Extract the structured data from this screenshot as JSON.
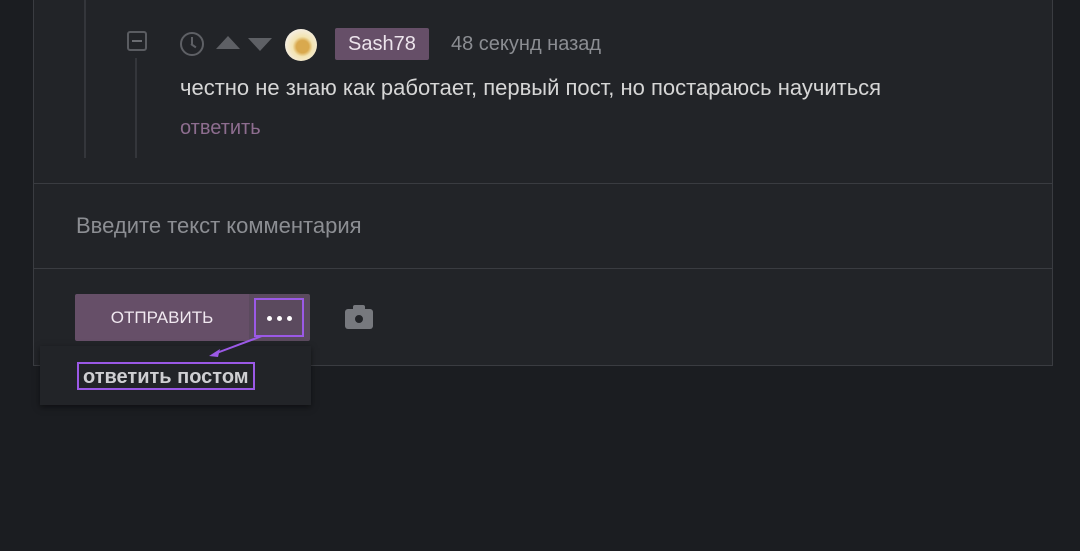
{
  "comment": {
    "author": "Sash78",
    "time": "48 секунд назад",
    "text": "честно не знаю как работает, первый пост, но постараюсь научиться",
    "reply_label": "ответить"
  },
  "composer": {
    "placeholder": "Введите текст комментария",
    "send_label": "ОТПРАВИТЬ"
  },
  "menu": {
    "reply_with_post": "ответить постом"
  },
  "icons": [
    "collapse-icon",
    "clock-icon",
    "upvote-icon",
    "downvote-icon",
    "more-dots-icon",
    "camera-icon"
  ],
  "colors": {
    "accent": "#664f68",
    "highlight": "#9b59e6",
    "background": "#1b1d21"
  }
}
